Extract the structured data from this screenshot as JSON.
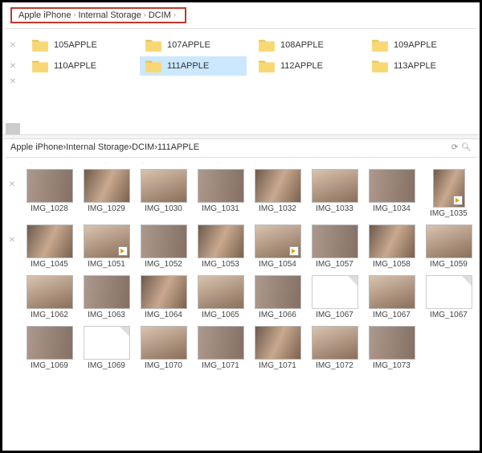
{
  "pane1": {
    "breadcrumb": [
      "Apple iPhone",
      "Internal Storage",
      "DCIM"
    ],
    "folders": [
      {
        "name": "105APPLE",
        "selected": false
      },
      {
        "name": "107APPLE",
        "selected": false
      },
      {
        "name": "108APPLE",
        "selected": false
      },
      {
        "name": "109APPLE",
        "selected": false
      },
      {
        "name": "110APPLE",
        "selected": false
      },
      {
        "name": "111APPLE",
        "selected": true
      },
      {
        "name": "112APPLE",
        "selected": false
      },
      {
        "name": "113APPLE",
        "selected": false
      }
    ]
  },
  "pane2": {
    "breadcrumb": [
      "Apple iPhone",
      "Internal Storage",
      "DCIM",
      "111APPLE"
    ],
    "rows": [
      [
        {
          "label": "IMG_1028",
          "kind": "img"
        },
        {
          "label": "IMG_1029",
          "kind": "img"
        },
        {
          "label": "IMG_1030",
          "kind": "img"
        },
        {
          "label": "IMG_1031",
          "kind": "img"
        },
        {
          "label": "IMG_1032",
          "kind": "img"
        },
        {
          "label": "IMG_1033",
          "kind": "img"
        },
        {
          "label": "IMG_1034",
          "kind": "img"
        },
        {
          "label": "IMG_1035",
          "kind": "vid-vert"
        }
      ],
      [
        {
          "label": "IMG_1045",
          "kind": "img"
        },
        {
          "label": "IMG_1051",
          "kind": "vid"
        },
        {
          "label": "IMG_1052",
          "kind": "img"
        },
        {
          "label": "IMG_1053",
          "kind": "img"
        },
        {
          "label": "IMG_1054",
          "kind": "vid"
        },
        {
          "label": "IMG_1057",
          "kind": "img"
        },
        {
          "label": "IMG_1058",
          "kind": "img"
        },
        {
          "label": "IMG_1059",
          "kind": "img"
        }
      ],
      [
        {
          "label": "IMG_1062",
          "kind": "img"
        },
        {
          "label": "IMG_1063",
          "kind": "img"
        },
        {
          "label": "IMG_1064",
          "kind": "img"
        },
        {
          "label": "IMG_1065",
          "kind": "img"
        },
        {
          "label": "IMG_1066",
          "kind": "img"
        },
        {
          "label": "IMG_1067",
          "kind": "blank"
        },
        {
          "label": "IMG_1067",
          "kind": "img"
        },
        {
          "label": "IMG_1067",
          "kind": "blank"
        }
      ],
      [
        {
          "label": "IMG_1069",
          "kind": "img"
        },
        {
          "label": "IMG_1069",
          "kind": "blank"
        },
        {
          "label": "IMG_1070",
          "kind": "img"
        },
        {
          "label": "IMG_1071",
          "kind": "img"
        },
        {
          "label": "IMG_1071",
          "kind": "img"
        },
        {
          "label": "IMG_1072",
          "kind": "img"
        },
        {
          "label": "IMG_1073",
          "kind": "img"
        },
        {
          "label": "",
          "kind": "none"
        }
      ]
    ]
  }
}
